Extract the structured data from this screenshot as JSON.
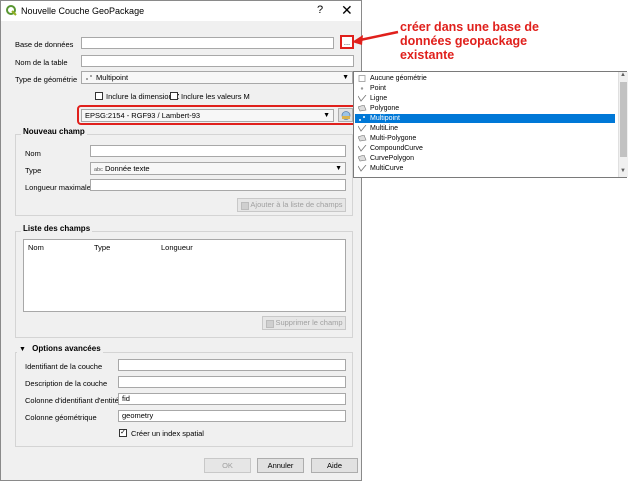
{
  "window": {
    "title": "Nouvelle Couche GeoPackage",
    "help": "?",
    "close": "✕"
  },
  "form": {
    "database_label": "Base de données",
    "database_value": "",
    "browse_button": "...",
    "table_label": "Nom de la table",
    "table_value": "",
    "geometry_label": "Type de géométrie",
    "geometry_value": "Multipoint",
    "include_z": "Inclure la dimension Z",
    "include_m": "Inclure les valeurs M",
    "crs_value": "EPSG:2154 - RGF93 / Lambert-93"
  },
  "new_field": {
    "title": "Nouveau champ",
    "name_label": "Nom",
    "type_label": "Type",
    "type_value": "Donnée texte",
    "type_icon_text": "abc",
    "max_length_label": "Longueur maximale",
    "add_button": "Ajouter à la liste de champs"
  },
  "field_list": {
    "title": "Liste des champs",
    "columns": [
      "Nom",
      "Type",
      "Longueur"
    ],
    "remove_button": "Supprimer le champ"
  },
  "advanced": {
    "title": "Options avancées",
    "layer_id_label": "Identifiant de la couche",
    "layer_id_value": "",
    "layer_desc_label": "Description de la couche",
    "layer_desc_value": "",
    "fid_label": "Colonne d'identifiant d'entité",
    "fid_value": "fid",
    "geom_col_label": "Colonne géométrique",
    "geom_col_value": "geometry",
    "spatial_index_label": "Créer un index spatial",
    "spatial_index_checked": true
  },
  "buttons": {
    "ok": "OK",
    "cancel": "Annuler",
    "help": "Aide"
  },
  "annotation": {
    "line1": "créer dans une base de",
    "line2": "données geopackage",
    "line3": "existante",
    "color": "#e0201c"
  },
  "geometry_dropdown": {
    "items": [
      "Aucune géométrie",
      "Point",
      "Ligne",
      "Polygone",
      "Multipoint",
      "MultiLine",
      "Multi-Polygone",
      "CompoundCurve",
      "CurvePolygon",
      "MultiCurve"
    ],
    "selected": "Multipoint",
    "selection_color": "#0078d7"
  }
}
